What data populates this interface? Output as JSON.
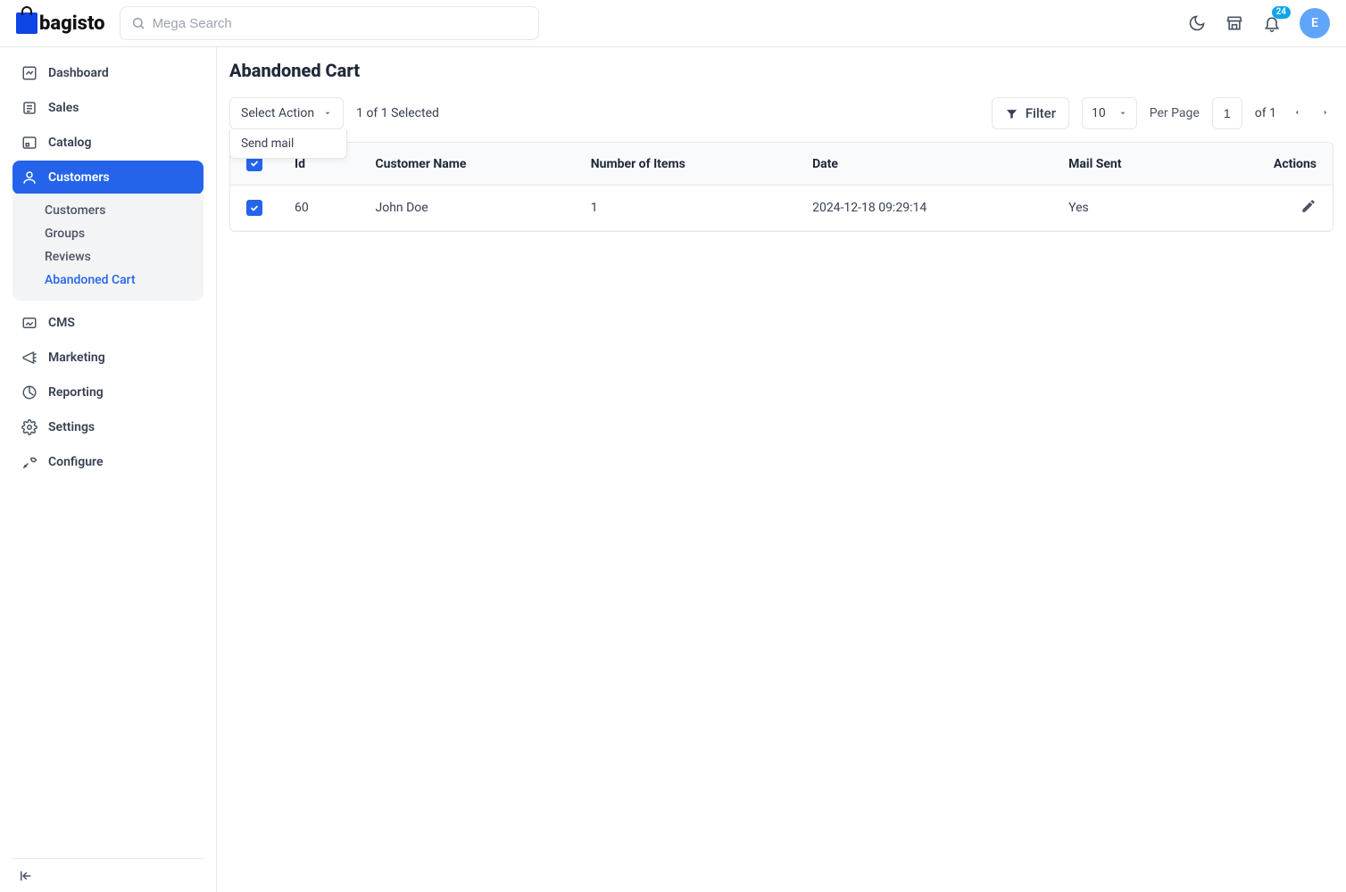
{
  "header": {
    "brand": "bagisto",
    "search_placeholder": "Mega Search",
    "notification_count": "24",
    "avatar_initial": "E"
  },
  "sidebar": {
    "items": [
      {
        "label": "Dashboard"
      },
      {
        "label": "Sales"
      },
      {
        "label": "Catalog"
      },
      {
        "label": "Customers",
        "active": true,
        "sub": [
          {
            "label": "Customers"
          },
          {
            "label": "Groups"
          },
          {
            "label": "Reviews"
          },
          {
            "label": "Abandoned Cart",
            "active": true
          }
        ]
      },
      {
        "label": "CMS"
      },
      {
        "label": "Marketing"
      },
      {
        "label": "Reporting"
      },
      {
        "label": "Settings"
      },
      {
        "label": "Configure"
      }
    ]
  },
  "page": {
    "title": "Abandoned Cart"
  },
  "toolbar": {
    "select_action_label": "Select Action",
    "dropdown_items": [
      "Send mail"
    ],
    "selection_text": "1 of 1 Selected",
    "filter_label": "Filter",
    "per_page_value": "10",
    "per_page_label": "Per Page",
    "page_current": "1",
    "of_pages": "of 1"
  },
  "table": {
    "columns": [
      "Id",
      "Customer Name",
      "Number of Items",
      "Date",
      "Mail Sent",
      "Actions"
    ],
    "rows": [
      {
        "id": "60",
        "customer": "John Doe",
        "items": "1",
        "date": "2024-12-18 09:29:14",
        "mail_sent": "Yes"
      }
    ]
  }
}
